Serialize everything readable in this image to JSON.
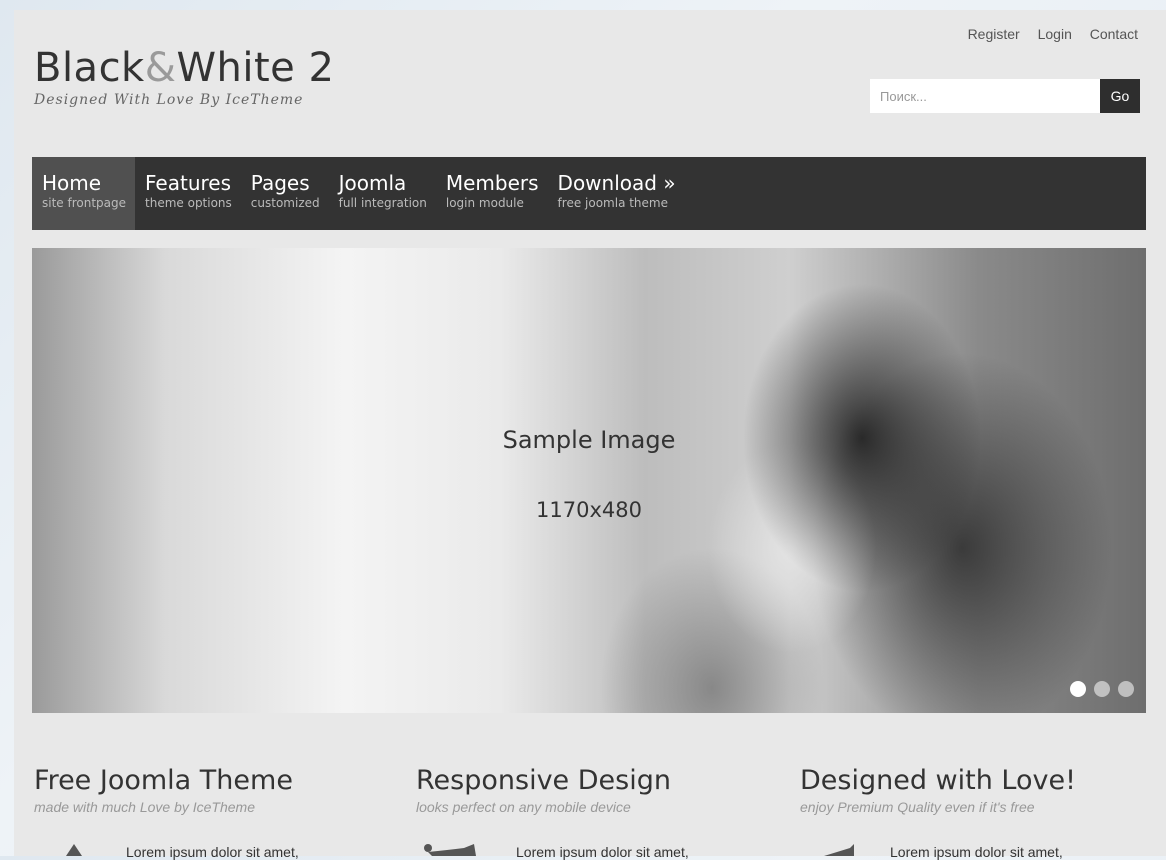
{
  "header": {
    "logo_prefix": "Black",
    "logo_amp": "&",
    "logo_suffix": "White 2",
    "tagline": "Designed With Love By IceTheme",
    "top_links": [
      "Register",
      "Login",
      "Contact"
    ],
    "search_placeholder": "Поиск...",
    "search_button": "Go"
  },
  "nav": [
    {
      "label": "Home",
      "desc": "site frontpage",
      "active": true
    },
    {
      "label": "Features",
      "desc": "theme options"
    },
    {
      "label": "Pages",
      "desc": "customized"
    },
    {
      "label": "Joomla",
      "desc": "full integration"
    },
    {
      "label": "Members",
      "desc": "login module"
    },
    {
      "label": "Download »",
      "desc": "free joomla theme"
    }
  ],
  "slider": {
    "title": "Sample Image",
    "size": "1170x480",
    "dots_total": 3,
    "dots_active": 1
  },
  "features": [
    {
      "title": "Free Joomla Theme",
      "tagline": "made with much Love by IceTheme",
      "body": "Lorem ipsum dolor sit amet,",
      "icon": "triangle-icon"
    },
    {
      "title": "Responsive Design",
      "tagline": "looks perfect on any mobile device",
      "body": "Lorem ipsum dolor sit amet,",
      "icon": "devices-icon"
    },
    {
      "title": "Designed with Love!",
      "tagline": "enjoy Premium Quality even if it's free",
      "body": "Lorem ipsum dolor sit amet,",
      "icon": "heart-icon"
    }
  ],
  "colors": {
    "nav_bg": "#333333",
    "nav_active": "#505050",
    "page_bg": "#e8e8e8"
  }
}
